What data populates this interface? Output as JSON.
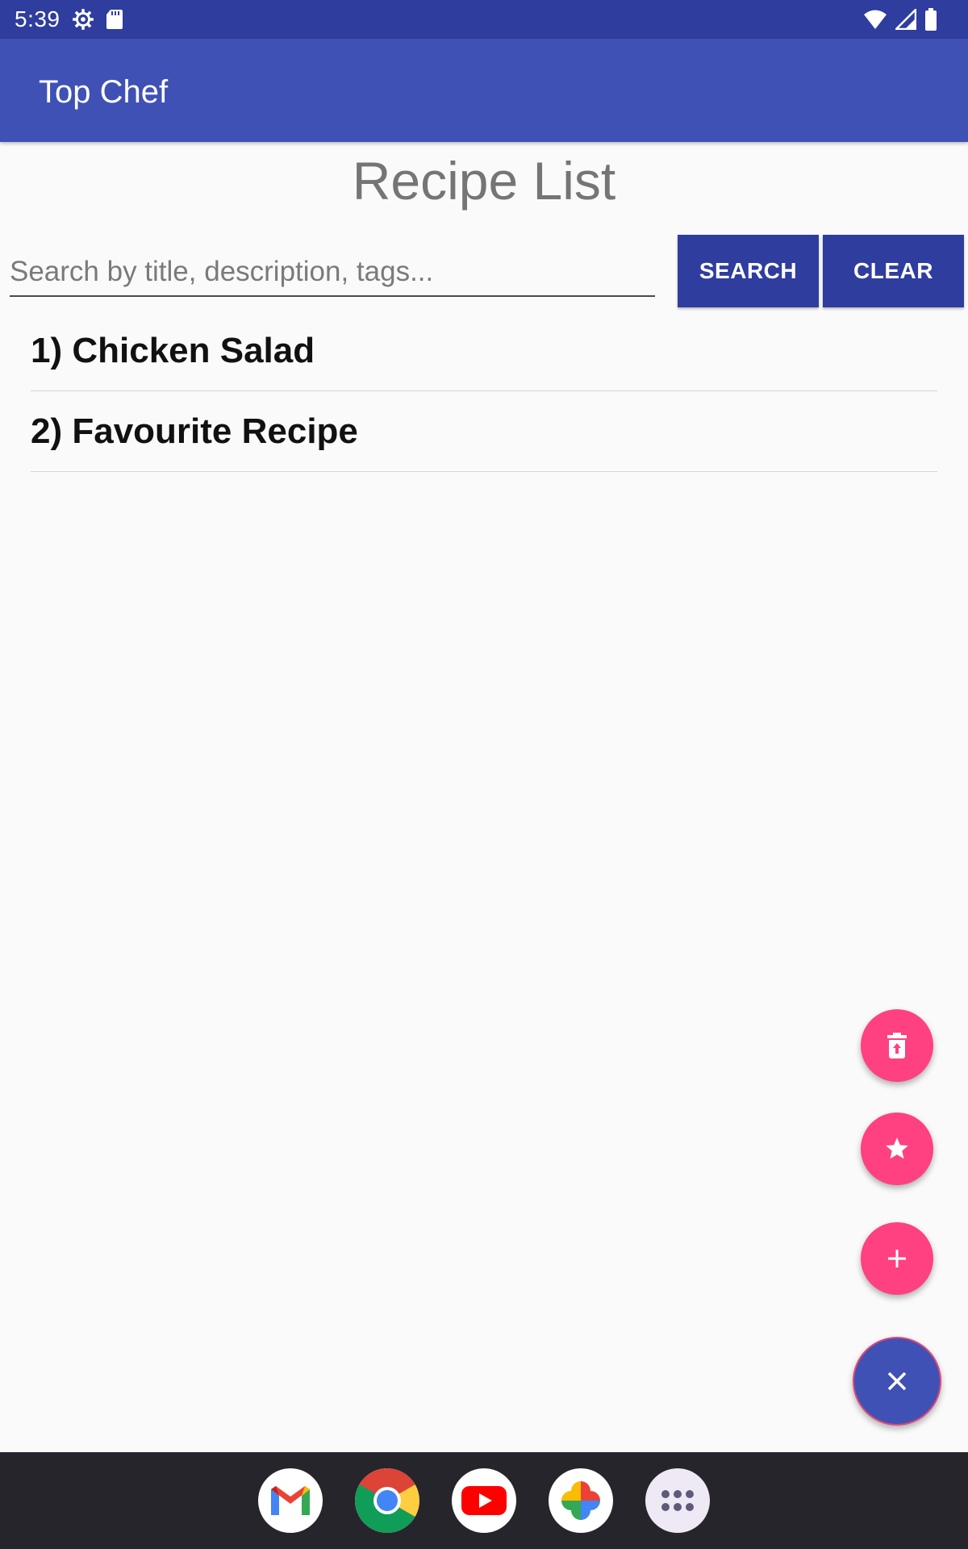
{
  "status_bar": {
    "time": "5:39",
    "icons": [
      "settings-icon",
      "sd-card-icon",
      "wifi-icon",
      "signal-icon",
      "battery-icon"
    ]
  },
  "app_bar": {
    "title": "Top Chef"
  },
  "main": {
    "title": "Recipe List",
    "search": {
      "placeholder": "Search by title, description, tags...",
      "value": ""
    },
    "search_button": "SEARCH",
    "clear_button": "CLEAR",
    "recipes": [
      {
        "label": "1) Chicken Salad"
      },
      {
        "label": "2) Favourite Recipe"
      }
    ]
  },
  "fabs": {
    "icons": [
      "delete-icon",
      "star-icon",
      "add-icon",
      "close-icon"
    ],
    "accent_color": "#ff4081",
    "primary_color": "#3f51b5"
  },
  "dock": {
    "apps": [
      "gmail-icon",
      "chrome-icon",
      "youtube-icon",
      "photos-icon",
      "app-drawer-icon"
    ]
  },
  "colors": {
    "status_bar": "#2f3d9e",
    "app_bar": "#3f51b5",
    "button": "#2f3d9e",
    "background": "#fafafa"
  }
}
